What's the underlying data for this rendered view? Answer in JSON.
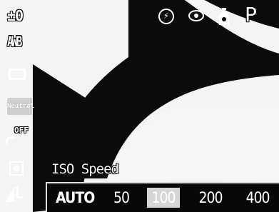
{
  "left_bar": {
    "exposure_comp": "±0",
    "white_balance": "AWB",
    "drive_mode_icon": "single-frame-icon",
    "photo_effect": "Neutral",
    "stitch_assist": "OFF",
    "metering_icon": "evaluative-metering-icon",
    "resolution": "L"
  },
  "top_right": {
    "flash_icon": "flash-off-icon",
    "flash_glyph": "⚡",
    "red_eye_icon": "red-eye-reduction-icon",
    "self_timer_icon": "self-timer-icon",
    "shooting_mode": "P"
  },
  "iso_menu": {
    "title": "ISO Speed",
    "options": [
      "AUTO",
      "50",
      "100",
      "200",
      "400"
    ],
    "selected": "100"
  },
  "colors": {
    "overlay_text": "#ffffff",
    "background": "#f4f4f4",
    "scene_dark": "#0a0a0a",
    "selection": "#d6d6d6"
  }
}
